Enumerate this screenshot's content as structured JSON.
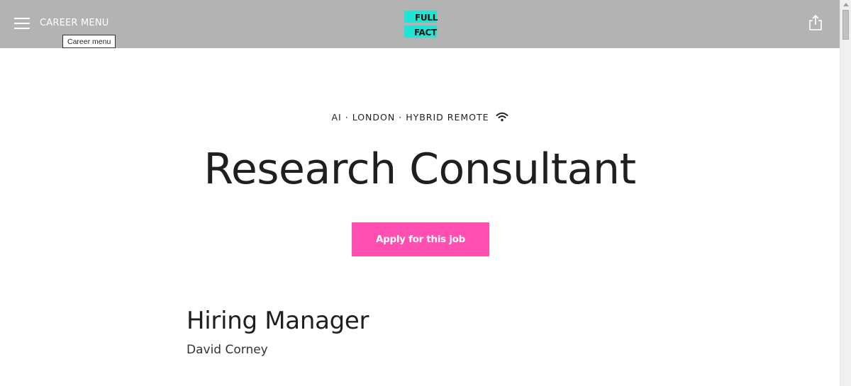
{
  "header": {
    "menu_label": "CAREER MENU",
    "menu_tooltip": "Career menu",
    "logo": {
      "line1": "FULL",
      "line2": "FACT",
      "brand_color": "#1fe6d4"
    },
    "share_icon": "share-icon",
    "menu_icon": "hamburger-icon",
    "bar_color": "#b3b3b3"
  },
  "job": {
    "meta_team": "AI",
    "meta_sep1": "·",
    "meta_location": "LONDON",
    "meta_sep2": "·",
    "meta_work_type": "HYBRID REMOTE",
    "remote_icon": "wifi-icon",
    "title": "Research Consultant",
    "apply_label": "Apply for this job",
    "apply_color": "#ff4fb0"
  },
  "hiring_manager": {
    "heading": "Hiring Manager",
    "name": "David Corney"
  }
}
